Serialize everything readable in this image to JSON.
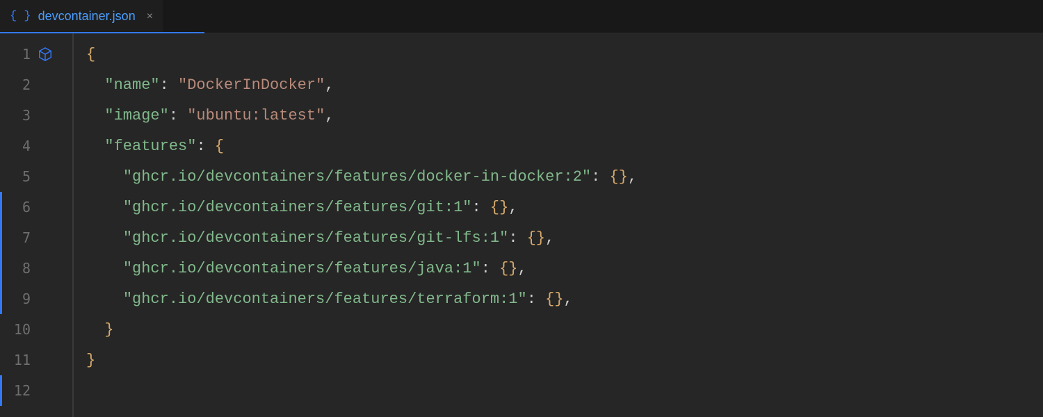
{
  "tab": {
    "filename": "devcontainer.json",
    "close_symbol": "×",
    "brace_glyph": "{ }"
  },
  "gutter": {
    "line_numbers": [
      "1",
      "2",
      "3",
      "4",
      "5",
      "6",
      "7",
      "8",
      "9",
      "10",
      "11",
      "12"
    ]
  },
  "code": {
    "lines": [
      {
        "indent": 0,
        "tokens": [
          {
            "cls": "tok-brace",
            "txt": "{"
          }
        ]
      },
      {
        "indent": 1,
        "tokens": [
          {
            "cls": "tok-key",
            "txt": "\"name\""
          },
          {
            "cls": "tok-colon",
            "txt": ": "
          },
          {
            "cls": "tok-str",
            "txt": "\"DockerInDocker\""
          },
          {
            "cls": "tok-comma",
            "txt": ","
          }
        ]
      },
      {
        "indent": 1,
        "tokens": [
          {
            "cls": "tok-key",
            "txt": "\"image\""
          },
          {
            "cls": "tok-colon",
            "txt": ": "
          },
          {
            "cls": "tok-str",
            "txt": "\"ubuntu:latest\""
          },
          {
            "cls": "tok-comma",
            "txt": ","
          }
        ]
      },
      {
        "indent": 1,
        "tokens": [
          {
            "cls": "tok-key",
            "txt": "\"features\""
          },
          {
            "cls": "tok-colon",
            "txt": ": "
          },
          {
            "cls": "tok-brace",
            "txt": "{"
          }
        ]
      },
      {
        "indent": 2,
        "tokens": [
          {
            "cls": "tok-key",
            "txt": "\"ghcr.io/devcontainers/features/docker-in-docker:2\""
          },
          {
            "cls": "tok-colon",
            "txt": ": "
          },
          {
            "cls": "tok-brace",
            "txt": "{}"
          },
          {
            "cls": "tok-comma",
            "txt": ","
          }
        ]
      },
      {
        "indent": 2,
        "tokens": [
          {
            "cls": "tok-key",
            "txt": "\"ghcr.io/devcontainers/features/git:1\""
          },
          {
            "cls": "tok-colon",
            "txt": ": "
          },
          {
            "cls": "tok-brace",
            "txt": "{}"
          },
          {
            "cls": "tok-comma",
            "txt": ","
          }
        ]
      },
      {
        "indent": 2,
        "tokens": [
          {
            "cls": "tok-key",
            "txt": "\"ghcr.io/devcontainers/features/git-lfs:1\""
          },
          {
            "cls": "tok-colon",
            "txt": ": "
          },
          {
            "cls": "tok-brace",
            "txt": "{}"
          },
          {
            "cls": "tok-comma",
            "txt": ","
          }
        ]
      },
      {
        "indent": 2,
        "tokens": [
          {
            "cls": "tok-key",
            "txt": "\"ghcr.io/devcontainers/features/java:1\""
          },
          {
            "cls": "tok-colon",
            "txt": ": "
          },
          {
            "cls": "tok-brace",
            "txt": "{}"
          },
          {
            "cls": "tok-comma",
            "txt": ","
          }
        ]
      },
      {
        "indent": 2,
        "tokens": [
          {
            "cls": "tok-key",
            "txt": "\"ghcr.io/devcontainers/features/terraform:1\""
          },
          {
            "cls": "tok-colon",
            "txt": ": "
          },
          {
            "cls": "tok-brace",
            "txt": "{}"
          },
          {
            "cls": "tok-comma",
            "txt": ","
          }
        ]
      },
      {
        "indent": 1,
        "tokens": [
          {
            "cls": "tok-brace",
            "txt": "}"
          }
        ]
      },
      {
        "indent": 0,
        "tokens": [
          {
            "cls": "tok-brace",
            "txt": "}"
          }
        ]
      },
      {
        "indent": 0,
        "tokens": []
      }
    ],
    "indent_unit": "  ",
    "left_bar_rows": [
      6,
      7,
      8,
      9,
      12
    ]
  }
}
